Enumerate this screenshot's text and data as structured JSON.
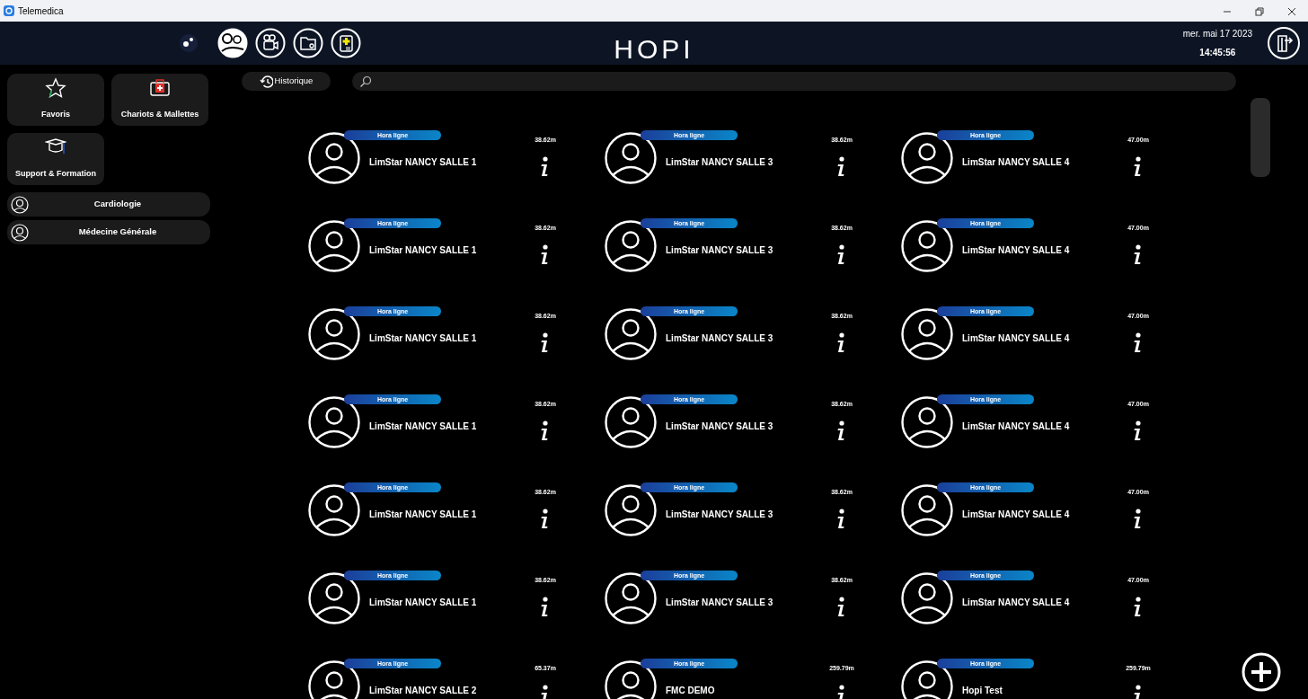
{
  "window": {
    "title": "Telemedica"
  },
  "header": {
    "nav": [
      {
        "kind": "settings",
        "selected": false
      },
      {
        "kind": "contacts",
        "selected": true
      },
      {
        "kind": "video",
        "selected": false
      },
      {
        "kind": "folder",
        "selected": false
      },
      {
        "kind": "clipboard",
        "selected": false
      }
    ],
    "logo": "HOPI",
    "date": "mer. mai 17 2023",
    "time": "14:45:56"
  },
  "sidebar": {
    "tiles": [
      {
        "kind": "star",
        "label": "Favoris"
      },
      {
        "kind": "medkit",
        "label": "Chariots & Mallettes"
      },
      {
        "kind": "cap",
        "label": "Support & Formation"
      }
    ],
    "groups": [
      {
        "label": "Cardiologie"
      },
      {
        "label": "Médecine Générale"
      }
    ]
  },
  "toolbar": {
    "history": "Historique"
  },
  "contacts": [
    {
      "status": "Hora ligne",
      "name": "LimStar NANCY SALLE 1",
      "distance": "38.62m"
    },
    {
      "status": "Hora ligne",
      "name": "LimStar NANCY SALLE 3",
      "distance": "38.62m"
    },
    {
      "status": "Hora ligne",
      "name": "LimStar NANCY SALLE 4",
      "distance": "47.00m"
    },
    {
      "status": "Hora ligne",
      "name": "LimStar NANCY SALLE 1",
      "distance": "38.62m"
    },
    {
      "status": "Hora ligne",
      "name": "LimStar NANCY SALLE 3",
      "distance": "38.62m"
    },
    {
      "status": "Hora ligne",
      "name": "LimStar NANCY SALLE 4",
      "distance": "47.00m"
    },
    {
      "status": "Hora ligne",
      "name": "LimStar NANCY SALLE 1",
      "distance": "38.62m"
    },
    {
      "status": "Hora ligne",
      "name": "LimStar NANCY SALLE 3",
      "distance": "38.62m"
    },
    {
      "status": "Hora ligne",
      "name": "LimStar NANCY SALLE 4",
      "distance": "47.00m"
    },
    {
      "status": "Hora ligne",
      "name": "LimStar NANCY SALLE 1",
      "distance": "38.62m"
    },
    {
      "status": "Hora ligne",
      "name": "LimStar NANCY SALLE 3",
      "distance": "38.62m"
    },
    {
      "status": "Hora ligne",
      "name": "LimStar NANCY SALLE 4",
      "distance": "47.00m"
    },
    {
      "status": "Hora ligne",
      "name": "LimStar NANCY SALLE 1",
      "distance": "38.62m"
    },
    {
      "status": "Hora ligne",
      "name": "LimStar NANCY SALLE 3",
      "distance": "38.62m"
    },
    {
      "status": "Hora ligne",
      "name": "LimStar NANCY SALLE 4",
      "distance": "47.00m"
    },
    {
      "status": "Hora ligne",
      "name": "LimStar NANCY SALLE 1",
      "distance": "38.62m"
    },
    {
      "status": "Hora ligne",
      "name": "LimStar NANCY SALLE 3",
      "distance": "38.62m"
    },
    {
      "status": "Hora ligne",
      "name": "LimStar NANCY SALLE 4",
      "distance": "47.00m"
    },
    {
      "status": "Hora ligne",
      "name": "LimStar NANCY SALLE 2",
      "distance": "65.37m"
    },
    {
      "status": "Hora ligne",
      "name": "FMC DEMO",
      "distance": "259.79m"
    },
    {
      "status": "Hora ligne",
      "name": "Hopi Test",
      "distance": "259.79m"
    }
  ]
}
